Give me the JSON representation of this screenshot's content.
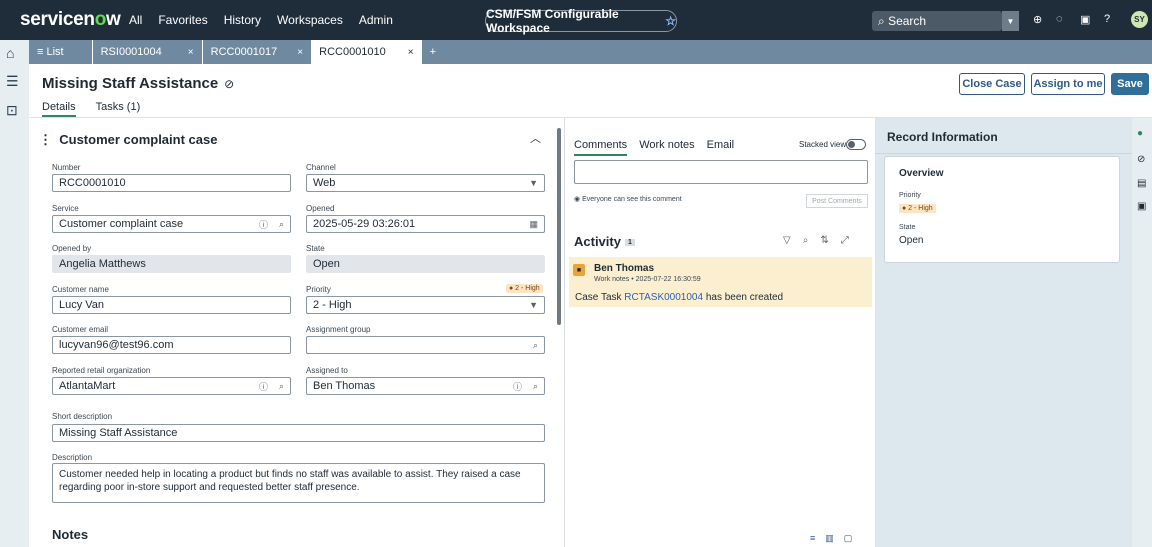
{
  "topbar": {
    "logo": "servicenow",
    "nav": [
      "All",
      "Favorites",
      "History",
      "Workspaces",
      "Admin"
    ],
    "workspace": "CSM/FSM Configurable Workspace",
    "search_placeholder": "Search",
    "avatar_initials": "SY"
  },
  "tabs": {
    "list_label": "List",
    "items": [
      "RSI0001004",
      "RCC0001017",
      "RCC0001010"
    ]
  },
  "header": {
    "title": "Missing Staff Assistance",
    "close_case": "Close Case",
    "assign_to_me": "Assign to me",
    "save": "Save",
    "subtabs": [
      "Details",
      "Tasks (1)"
    ]
  },
  "form": {
    "section_title": "Customer complaint case",
    "number_label": "Number",
    "number": "RCC0001010",
    "channel_label": "Channel",
    "channel": "Web",
    "service_label": "Service",
    "service": "Customer complaint case",
    "opened_label": "Opened",
    "opened": "2025-05-29 03:26:01",
    "opened_by_label": "Opened by",
    "opened_by": "Angelia Matthews",
    "state_label": "State",
    "state": "Open",
    "customer_name_label": "Customer name",
    "customer_name": "Lucy Van",
    "priority_label": "Priority",
    "priority": "2 - High",
    "priority_badge": "● 2 - High",
    "customer_email_label": "Customer email",
    "customer_email": "lucyvan96@test96.com",
    "assignment_group_label": "Assignment group",
    "assignment_group": "",
    "retail_org_label": "Reported retail organization",
    "retail_org": "AtlantaMart",
    "assigned_to_label": "Assigned to",
    "assigned_to": "Ben Thomas",
    "short_desc_label": "Short description",
    "short_desc": "Missing Staff Assistance",
    "description_label": "Description",
    "description": "Customer needed help in locating a product but finds no staff was available to assist. They raised a case regarding poor in-store support and requested better staff presence.",
    "notes_label": "Notes"
  },
  "activity": {
    "tabs": [
      "Comments",
      "Work notes",
      "Email"
    ],
    "stacked_view": "Stacked view",
    "visibility": "Everyone can see this comment",
    "post": "Post Comments",
    "heading": "Activity",
    "count": "1",
    "entry": {
      "author": "Ben Thomas",
      "meta": "Work notes • 2025-07-22 16:30:59",
      "text_prefix": "Case Task",
      "link": "RCTASK0001004",
      "text_suffix": "has been created"
    }
  },
  "record": {
    "heading": "Record Information",
    "overview": "Overview",
    "priority_label": "Priority",
    "priority": "● 2 - High",
    "state_label": "State",
    "state": "Open"
  }
}
